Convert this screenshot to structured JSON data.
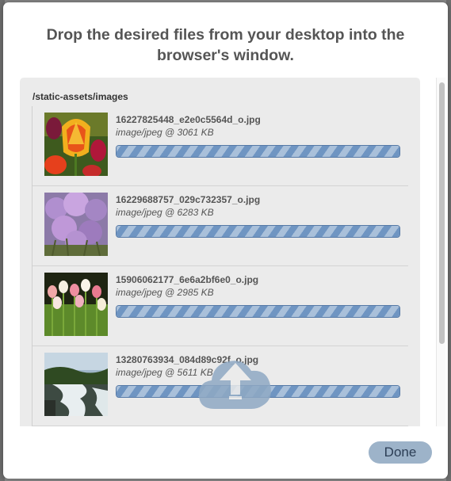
{
  "dialog": {
    "title": "Drop the desired files from your desktop into the browser's window.",
    "folder_path": "/static-assets/images",
    "done_label": "Done"
  },
  "files": [
    {
      "name": "16227825448_e2e0c5564d_o.jpg",
      "meta": "image/jpeg @ 3061 KB",
      "progress": 1.0,
      "thumb": "tulips-red-yellow"
    },
    {
      "name": "16229688757_029c732357_o.jpg",
      "meta": "image/jpeg @ 6283 KB",
      "progress": 1.0,
      "thumb": "purple-flowers"
    },
    {
      "name": "15906062177_6e6a2bf6e0_o.jpg",
      "meta": "image/jpeg @ 2985 KB",
      "progress": 1.0,
      "thumb": "tulip-field"
    },
    {
      "name": "13280763934_084d89c92f_o.jpg",
      "meta": "image/jpeg @ 5611 KB",
      "progress": 1.0,
      "thumb": "waterfall"
    }
  ],
  "icons": {
    "upload": "upload-cloud-icon"
  },
  "colors": {
    "progress_stripe_dark": "#6f95c2",
    "progress_stripe_light": "#a9c0da",
    "done_button": "#9db3c9"
  }
}
